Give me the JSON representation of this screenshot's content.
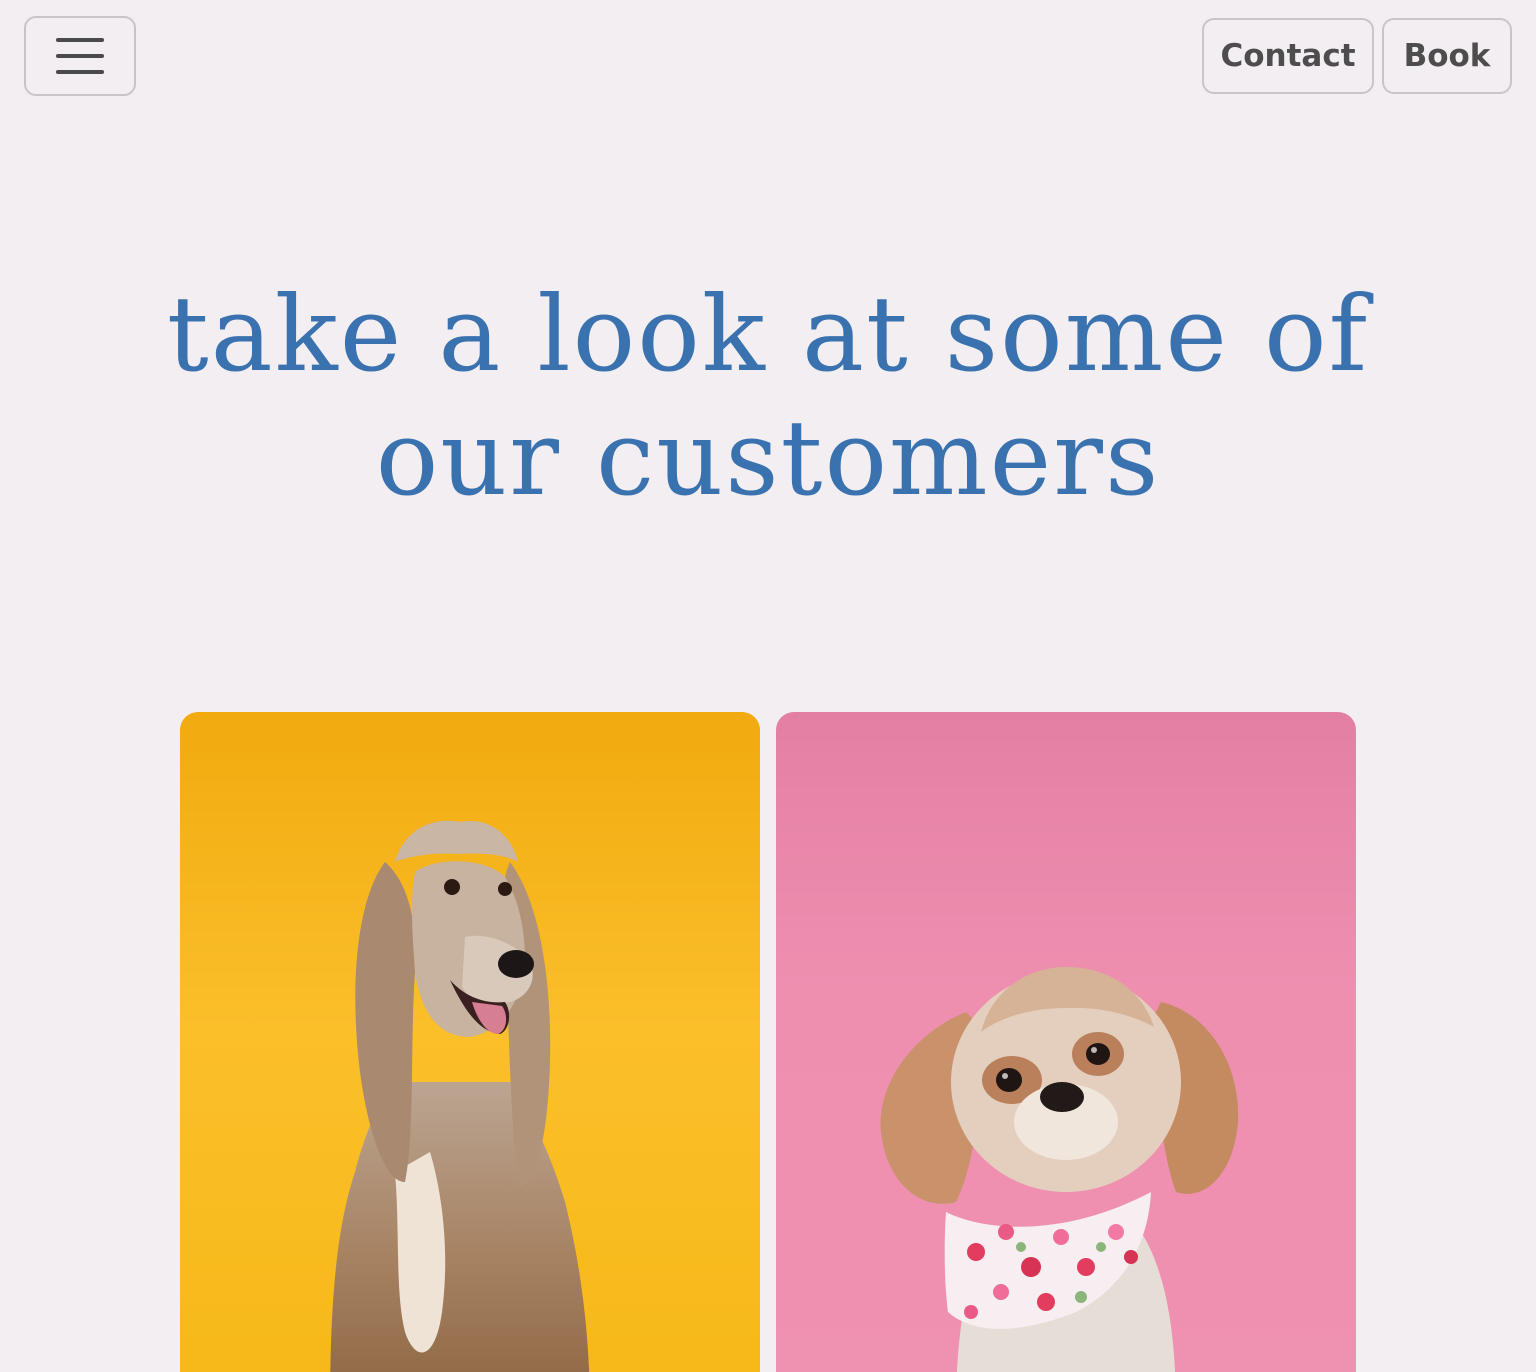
{
  "header": {
    "menu_icon": "hamburger-menu-icon",
    "contact_label": "Contact",
    "book_label": "Book",
    "button_border_color": "#c9c5c7",
    "button_text_color": "#4d4d4d"
  },
  "main": {
    "heading_line1": "take a look at some of",
    "heading_line2": "our customers",
    "heading_color": "#3a72b0",
    "background_color": "#f3eef1"
  },
  "gallery": {
    "photos": [
      {
        "subject": "afghan-hound-photo",
        "background_color": "#f9b81f"
      },
      {
        "subject": "shih-tzu-with-floral-bandana-photo",
        "background_color": "#ee8fb0"
      }
    ]
  }
}
